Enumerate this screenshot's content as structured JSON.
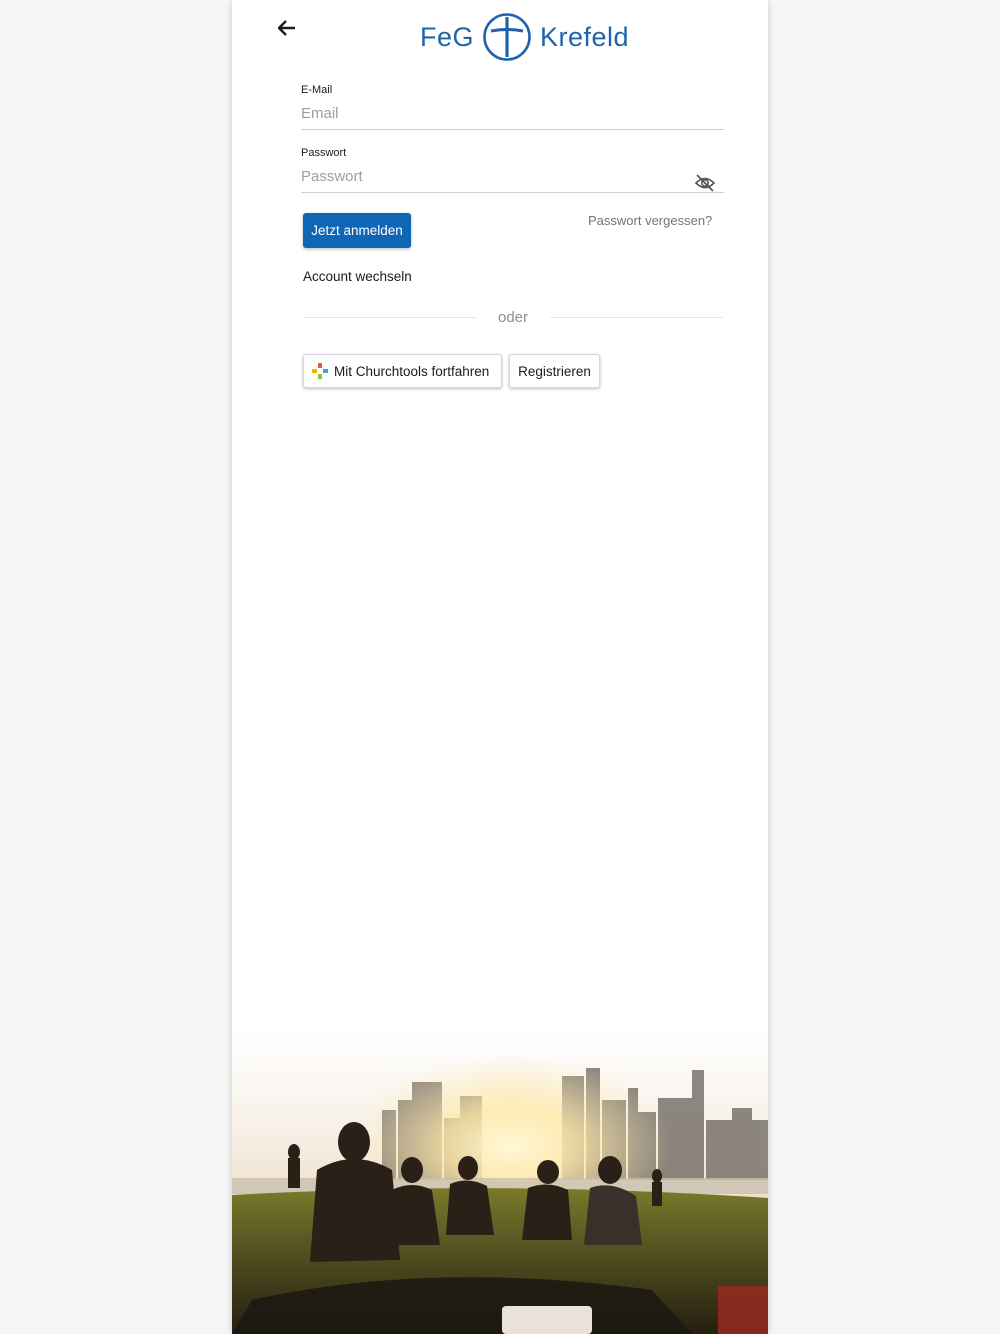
{
  "header": {
    "back_icon": "arrow-left-icon",
    "logo": {
      "left_word": "FeG",
      "right_word": "Krefeld",
      "mark_icon": "cross-circle-icon",
      "color": "#1f63aa"
    }
  },
  "form": {
    "email": {
      "label": "E-Mail",
      "placeholder": "Email",
      "value": ""
    },
    "password": {
      "label": "Passwort",
      "placeholder": "Passwort",
      "value": "",
      "toggle_icon": "eye-off-icon"
    },
    "login_button": "Jetzt anmelden",
    "forgot_link": "Passwort vergessen?",
    "switch_account_link": "Account wechseln",
    "divider_text": "oder",
    "churchtools_button": "Mit Churchtools fortfahren",
    "churchtools_icon": "churchtools-logo-icon",
    "register_button": "Registrieren"
  },
  "colors": {
    "primary": "#0e66b5",
    "brand": "#1f63aa"
  },
  "hero_image": "people-picnic-city-skyline-sunset"
}
